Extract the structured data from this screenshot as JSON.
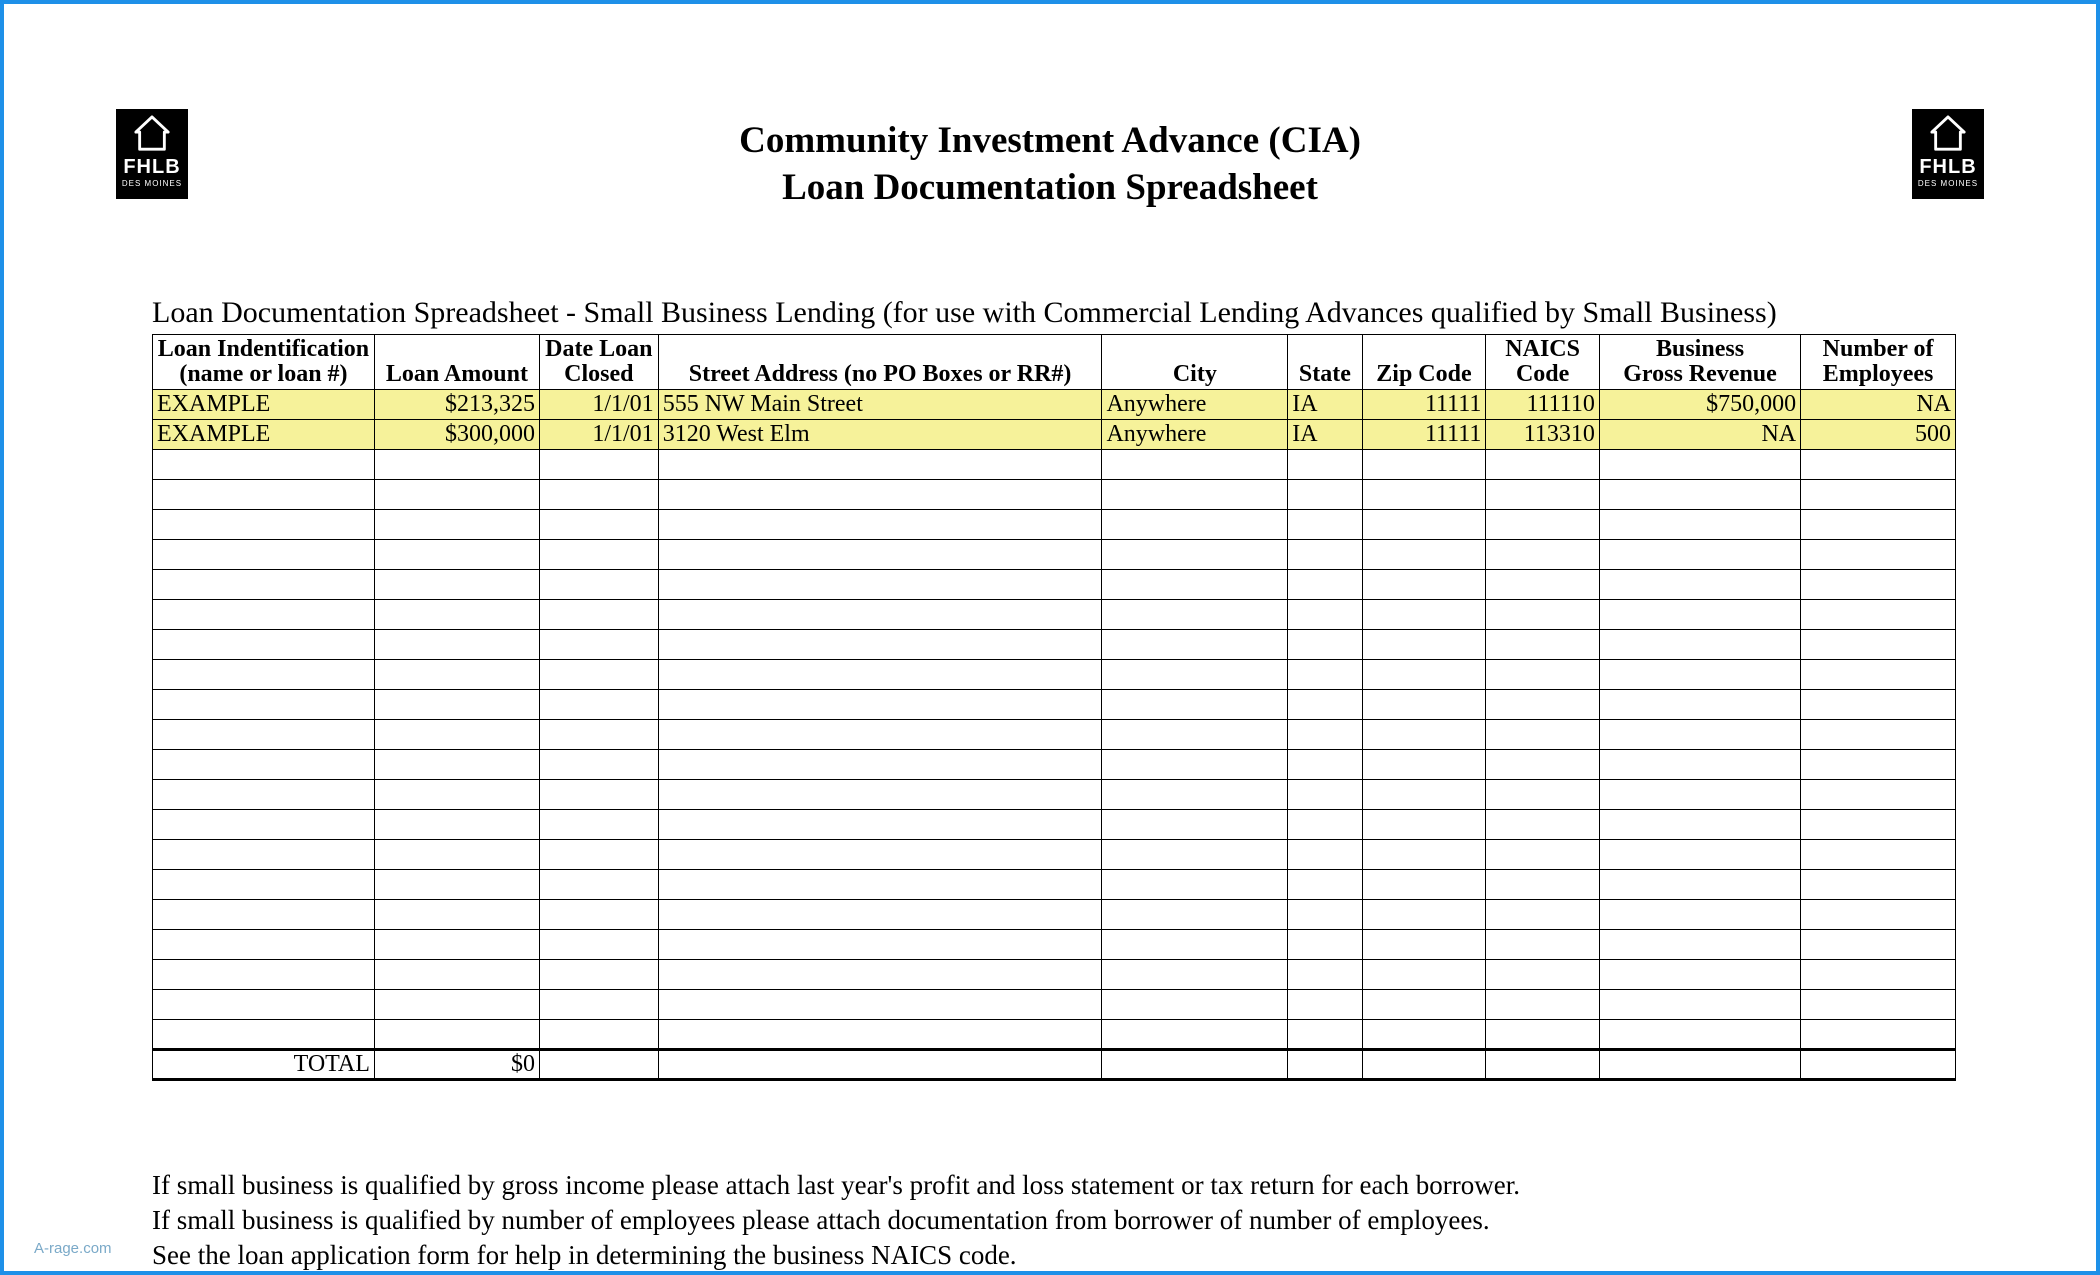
{
  "header": {
    "title1": "Community Investment Advance (CIA)",
    "title2": "Loan Documentation Spreadsheet",
    "logo_text": "FHLB",
    "logo_city": "DES MOINES"
  },
  "subtitle": "Loan Documentation Spreadsheet - Small Business Lending (for use with Commercial Lending Advances qualified by Small Business)",
  "columns": {
    "c1a": "Loan Indentification",
    "c1b": "(name or loan #)",
    "c2": "Loan Amount",
    "c3a": "Date Loan",
    "c3b": "Closed",
    "c4": "Street Address (no PO Boxes or RR#)",
    "c5": "City",
    "c6": "State",
    "c7": "Zip Code",
    "c8a": "NAICS",
    "c8b": "Code",
    "c9a": "Business",
    "c9b": "Gross Revenue",
    "c10a": "Number of",
    "c10b": "Employees"
  },
  "rows": [
    {
      "id": "EXAMPLE",
      "amount": "$213,325",
      "date": "1/1/01",
      "street": "555 NW Main Street",
      "city": "Anywhere",
      "state": "IA",
      "zip": "11111",
      "naics": "111110",
      "revenue": "$750,000",
      "employees": "NA"
    },
    {
      "id": "EXAMPLE",
      "amount": "$300,000",
      "date": "1/1/01",
      "street": "3120 West Elm",
      "city": "Anywhere",
      "state": "IA",
      "zip": "11111",
      "naics": "113310",
      "revenue": "NA",
      "employees": "500"
    }
  ],
  "blank_row_count": 20,
  "total": {
    "label": "TOTAL",
    "amount": "$0"
  },
  "footnotes": {
    "l1": "If small business is qualified by gross income please attach last year's profit and loss statement or tax return for each borrower.",
    "l2": "If small business is qualified by number of employees please attach documentation from borrower of number of employees.",
    "l3": "See the loan application form for help in determining the business NAICS code."
  },
  "watermark": "A-rage.com"
}
